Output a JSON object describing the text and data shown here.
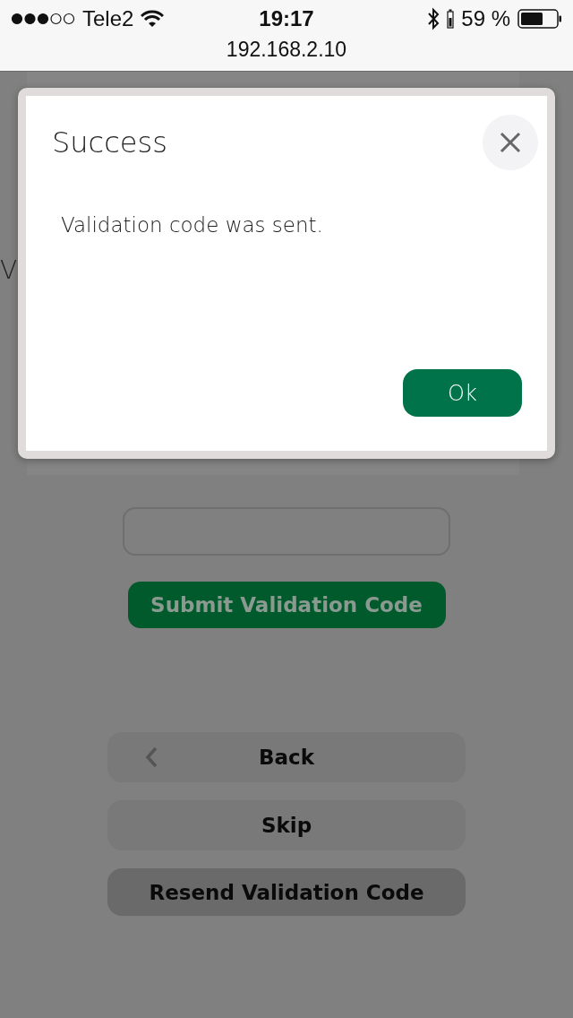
{
  "status_bar": {
    "carrier": "Tele2",
    "time": "19:17",
    "battery": "59 %",
    "url": "192.168.2.10"
  },
  "page": {
    "heading": "V",
    "submit_button": "Submit Validation Code",
    "buttons": [
      {
        "label": "Back",
        "kind": "back"
      },
      {
        "label": "Skip",
        "kind": "plain"
      },
      {
        "label": "Resend Validation Code",
        "kind": "emphasis"
      }
    ]
  },
  "dialog": {
    "title": "Success",
    "message": "Validation code was sent.",
    "ok_button": "Ok"
  }
}
